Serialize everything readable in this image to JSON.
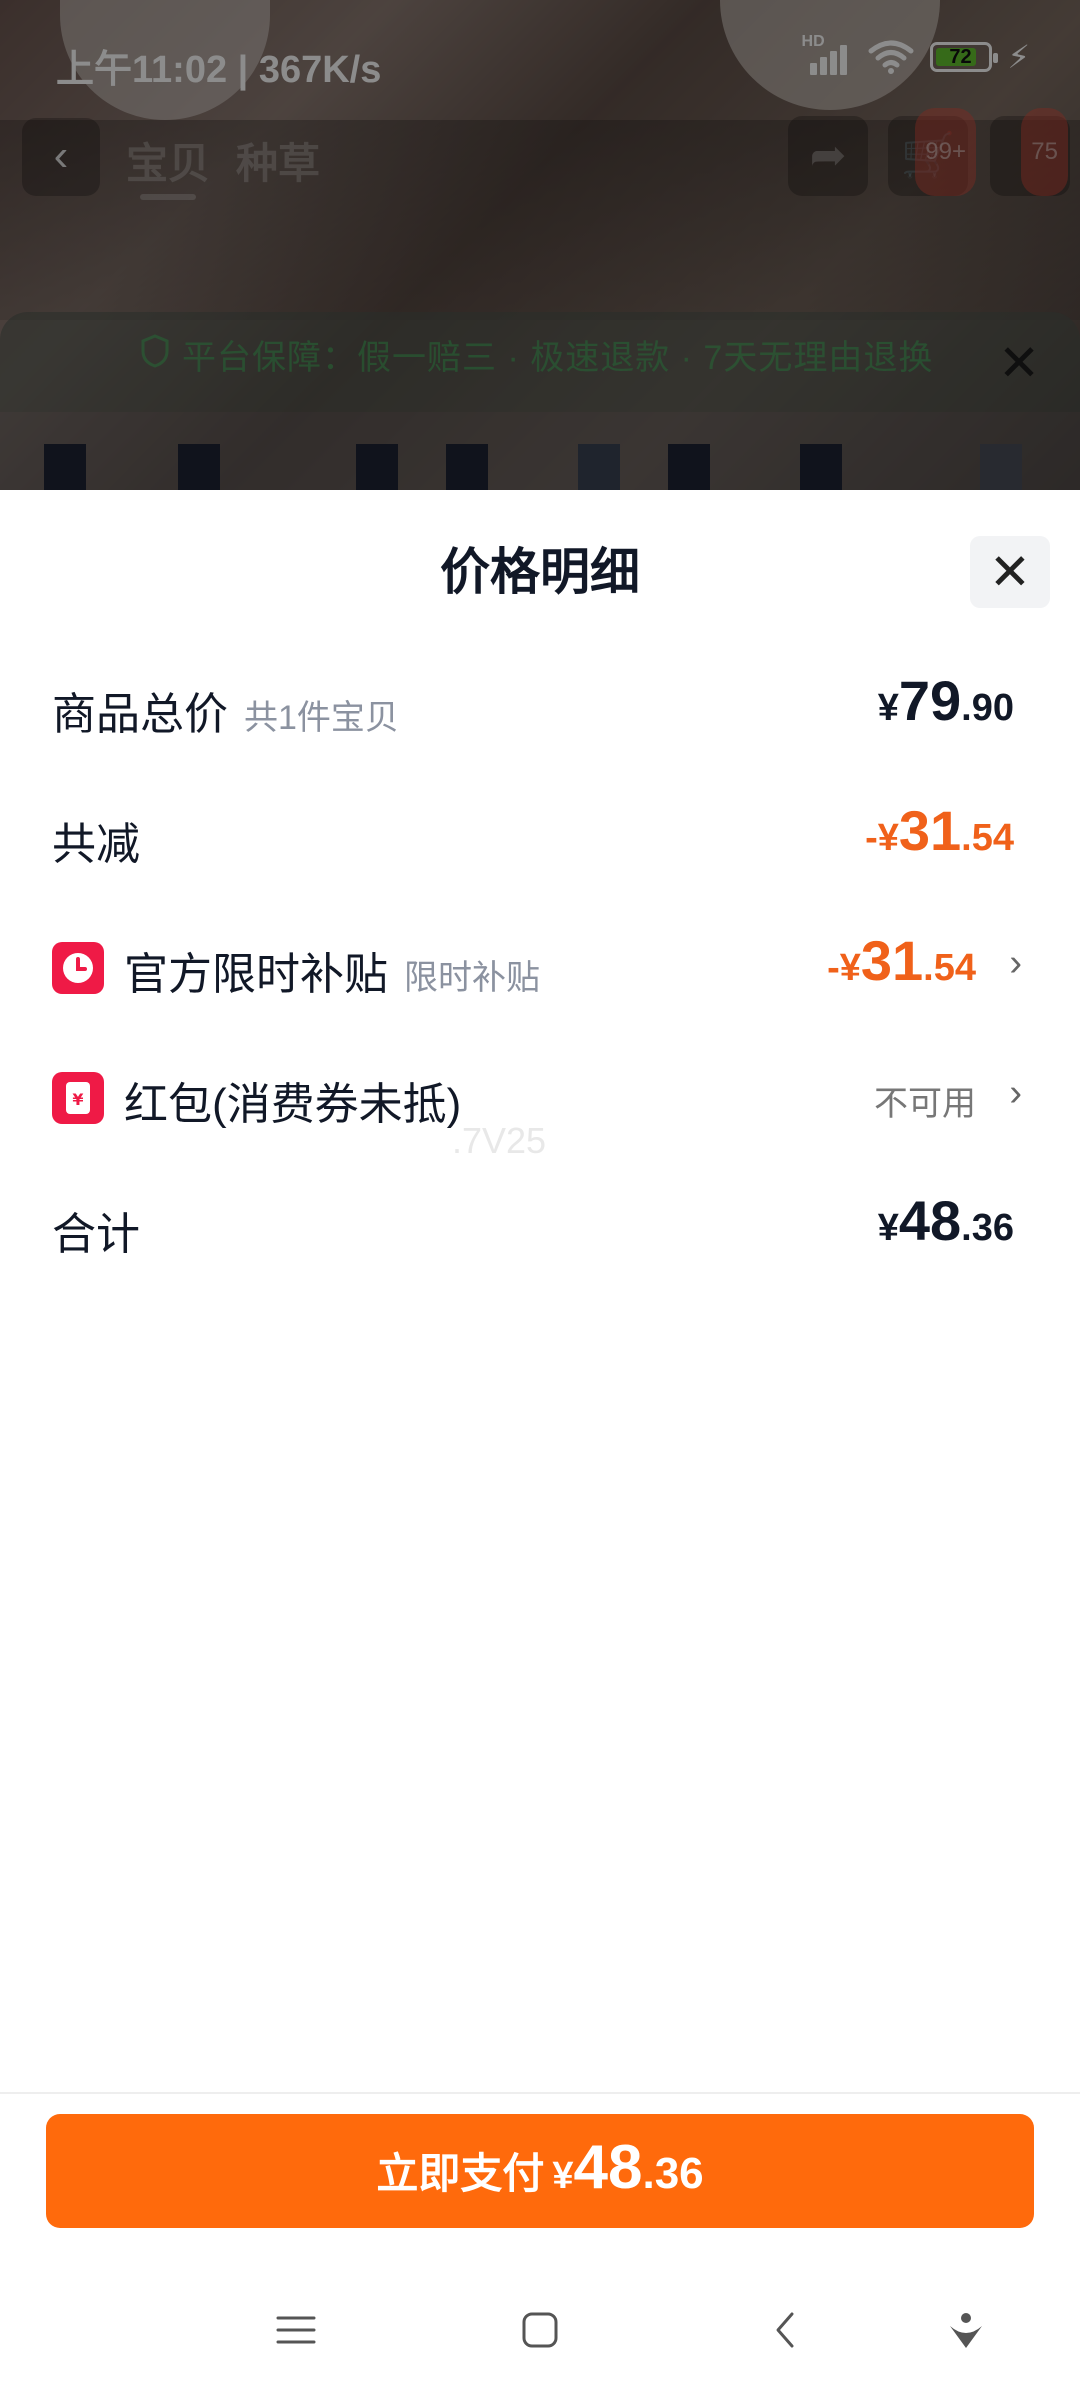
{
  "status_bar": {
    "time": "上午11:02 | 367K/s",
    "battery": "72"
  },
  "product_nav": {
    "tabs": [
      "宝贝",
      "种草"
    ],
    "cart_badge": "99+",
    "msg_badge": "75"
  },
  "guarantee_bar": {
    "text": "平台保障：假一赔三 · 极速退款 · 7天无理由退换"
  },
  "price_sheet": {
    "title": "价格明细",
    "rows": {
      "goods_total": {
        "label": "商品总价",
        "sub": "共1件宝贝",
        "price_symbol": "¥",
        "price_int": "79",
        "price_dec": ".90"
      },
      "total_reduction": {
        "label": "共减",
        "price_symbol": "-¥",
        "price_int": "31",
        "price_dec": ".54"
      },
      "official_subsidy": {
        "label": "官方限时补贴",
        "sub": "限时补贴",
        "price_symbol": "-¥",
        "price_int": "31",
        "price_dec": ".54"
      },
      "red_packet": {
        "label": "红包(消费券未抵)",
        "status": "不可用"
      },
      "sum": {
        "label": "合计",
        "price_symbol": "¥",
        "price_int": "48",
        "price_dec": ".36"
      }
    },
    "watermark": ".7V25"
  },
  "pay_button": {
    "label": "立即支付",
    "price_symbol": "¥",
    "price_int": "48",
    "price_dec": ".36"
  },
  "colors": {
    "accent": "#ff6a0c",
    "discount": "#f0611a",
    "icon_red": "#ef1a46"
  },
  "icons": [
    "back-icon",
    "share-icon",
    "cart-icon",
    "close-icon",
    "clock-icon",
    "red-packet-icon",
    "chevron-right-icon",
    "menu-icon",
    "home-icon",
    "nav-back-icon",
    "assistant-icon"
  ]
}
